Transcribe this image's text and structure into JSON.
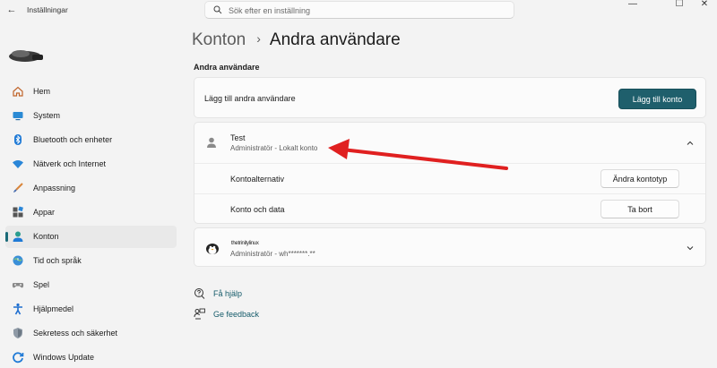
{
  "window": {
    "title": "Inställningar",
    "back_icon": "←",
    "minimize_icon": "—",
    "maximize_icon": "☐",
    "close_icon": "✕"
  },
  "search": {
    "placeholder": "Sök efter en inställning"
  },
  "sidebar": {
    "items": [
      {
        "label": "Hem",
        "icon": "home-icon"
      },
      {
        "label": "System",
        "icon": "system-icon"
      },
      {
        "label": "Bluetooth och enheter",
        "icon": "bluetooth-icon"
      },
      {
        "label": "Nätverk och Internet",
        "icon": "network-icon"
      },
      {
        "label": "Anpassning",
        "icon": "brush-icon"
      },
      {
        "label": "Appar",
        "icon": "apps-icon"
      },
      {
        "label": "Konton",
        "icon": "accounts-icon",
        "active": true
      },
      {
        "label": "Tid och språk",
        "icon": "time-language-icon"
      },
      {
        "label": "Spel",
        "icon": "gaming-icon"
      },
      {
        "label": "Hjälpmedel",
        "icon": "accessibility-icon"
      },
      {
        "label": "Sekretess och säkerhet",
        "icon": "privacy-shield-icon"
      },
      {
        "label": "Windows Update",
        "icon": "windows-update-icon"
      }
    ]
  },
  "breadcrumb": {
    "parent": "Konton",
    "separator": "›",
    "current": "Andra användare"
  },
  "section": {
    "title": "Andra användare"
  },
  "add_user": {
    "label": "Lägg till andra användare",
    "button": "Lägg till konto"
  },
  "users": [
    {
      "name": "Test",
      "role": "Administratör - Lokalt konto",
      "expanded": true,
      "options": [
        {
          "label": "Kontoalternativ",
          "button": "Ändra kontotyp"
        },
        {
          "label": "Konto och data",
          "button": "Ta bort"
        }
      ]
    },
    {
      "name": "thetrinitylinux",
      "role": "Administratör - wh*******.**",
      "expanded": false
    }
  ],
  "help": {
    "get_help": "Få hjälp",
    "feedback": "Ge feedback"
  },
  "colors": {
    "accent": "#1f5f6c",
    "arrow": "#e02020"
  }
}
